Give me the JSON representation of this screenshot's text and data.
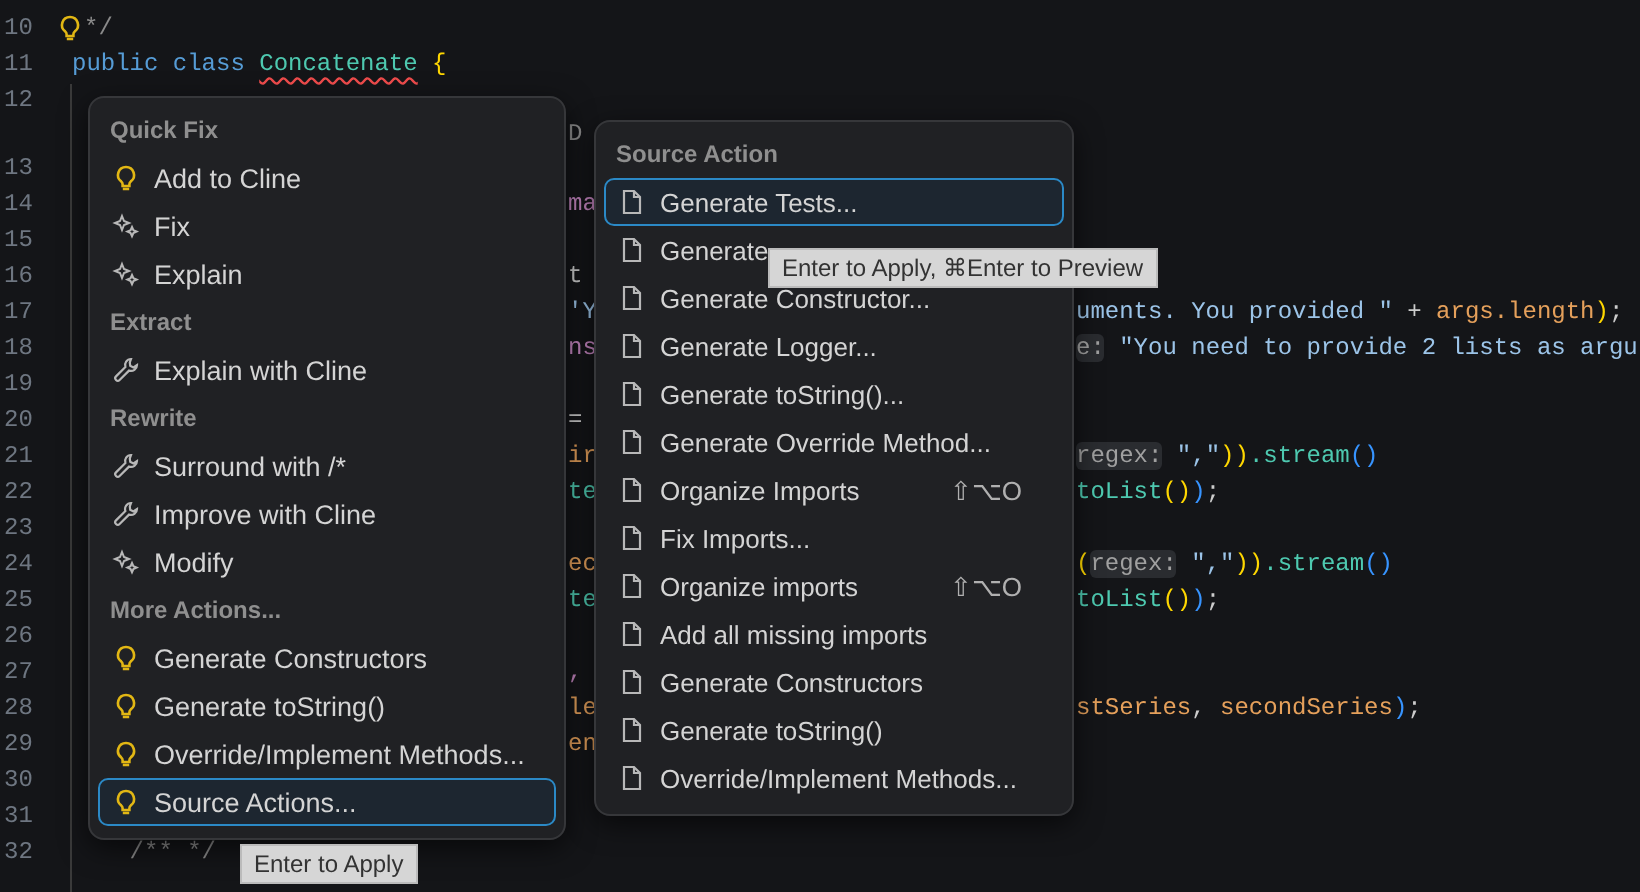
{
  "editor": {
    "lines": [
      {
        "kind": "code",
        "number": "10",
        "lightbulb": true,
        "main": [
          {
            "text": "*/",
            "kind": "comment"
          }
        ]
      },
      {
        "kind": "code",
        "number": "11",
        "main": [
          {
            "text": "public class ",
            "kind": "keyword"
          },
          {
            "text": "Concatenate",
            "kind": "type",
            "error": true
          },
          {
            "text": " {",
            "kind": "paren"
          }
        ]
      },
      {
        "kind": "code",
        "number": "12"
      },
      {
        "kind": "codelens",
        "mid": [
          {
            "text": "D",
            "kind": "lens"
          }
        ]
      },
      {
        "kind": "code",
        "number": "13"
      },
      {
        "kind": "code",
        "number": "14",
        "mid": [
          {
            "text": "ma",
            "kind": "purple"
          }
        ]
      },
      {
        "kind": "code",
        "number": "15"
      },
      {
        "kind": "code",
        "number": "16",
        "mid": [
          {
            "text": "t",
            "kind": "plain"
          }
        ]
      },
      {
        "kind": "code",
        "number": "17",
        "mid": [
          {
            "text": "'Y",
            "kind": "string"
          }
        ],
        "right": [
          {
            "text": "uments. You provided \"",
            "kind": "string"
          },
          {
            "text": " + ",
            "kind": "plain"
          },
          {
            "text": "args.length",
            "kind": "param"
          },
          {
            "text": ")",
            "kind": "paren"
          },
          {
            "text": ";",
            "kind": "plain"
          }
        ]
      },
      {
        "kind": "code",
        "number": "18",
        "mid": [
          {
            "text": "ns",
            "kind": "purple"
          }
        ],
        "right": [
          {
            "text": "e:",
            "kind": "hint"
          },
          {
            "text": " \"You need to provide 2 lists as argu",
            "kind": "string"
          }
        ]
      },
      {
        "kind": "code",
        "number": "19"
      },
      {
        "kind": "code",
        "number": "20",
        "mid": [
          {
            "text": "=",
            "kind": "plain"
          }
        ]
      },
      {
        "kind": "code",
        "number": "21",
        "mid": [
          {
            "text": "ir",
            "kind": "param"
          }
        ],
        "right": [
          {
            "text": "regex:",
            "kind": "hint"
          },
          {
            "text": " \",\"",
            "kind": "string"
          },
          {
            "text": "))",
            "kind": "paren"
          },
          {
            "text": ".stream",
            "kind": "type"
          },
          {
            "text": "()",
            "kind": "paren2"
          }
        ]
      },
      {
        "kind": "code",
        "number": "22",
        "mid": [
          {
            "text": "te",
            "kind": "type"
          }
        ],
        "right": [
          {
            "text": "toList",
            "kind": "type"
          },
          {
            "text": "()",
            "kind": "paren"
          },
          {
            "text": ")",
            "kind": "paren2"
          },
          {
            "text": ";",
            "kind": "plain"
          }
        ]
      },
      {
        "kind": "code",
        "number": "23"
      },
      {
        "kind": "code",
        "number": "24",
        "mid": [
          {
            "text": "ec",
            "kind": "param"
          }
        ],
        "right": [
          {
            "text": "(",
            "kind": "paren"
          },
          {
            "text": "regex:",
            "kind": "hint"
          },
          {
            "text": " \",\"",
            "kind": "string"
          },
          {
            "text": "))",
            "kind": "paren"
          },
          {
            "text": ".stream",
            "kind": "type"
          },
          {
            "text": "()",
            "kind": "paren2"
          }
        ]
      },
      {
        "kind": "code",
        "number": "25",
        "mid": [
          {
            "text": "te",
            "kind": "type"
          }
        ],
        "right": [
          {
            "text": "toList",
            "kind": "type"
          },
          {
            "text": "()",
            "kind": "paren"
          },
          {
            "text": ")",
            "kind": "paren2"
          },
          {
            "text": ";",
            "kind": "plain"
          }
        ]
      },
      {
        "kind": "code",
        "number": "26"
      },
      {
        "kind": "code",
        "number": "27",
        "mid": [
          {
            "text": ",",
            "kind": "purple"
          }
        ]
      },
      {
        "kind": "code",
        "number": "28",
        "mid": [
          {
            "text": "le",
            "kind": "param"
          }
        ],
        "right": [
          {
            "text": "stSeries",
            "kind": "param"
          },
          {
            "text": ", ",
            "kind": "plain"
          },
          {
            "text": "secondSeries",
            "kind": "param"
          },
          {
            "text": ")",
            "kind": "paren2"
          },
          {
            "text": ";",
            "kind": "plain"
          }
        ]
      },
      {
        "kind": "code",
        "number": "29",
        "mid": [
          {
            "text": "en",
            "kind": "param"
          }
        ]
      },
      {
        "kind": "code",
        "number": "30"
      },
      {
        "kind": "code",
        "number": "31"
      },
      {
        "kind": "code",
        "number": "32",
        "main": [
          {
            "text": "    /** */",
            "kind": "comment"
          }
        ]
      }
    ]
  },
  "quick_fix_menu": {
    "sections": [
      {
        "header": "Quick Fix",
        "items": [
          {
            "label": "Add to Cline",
            "kind": "bulb",
            "selected": false
          },
          {
            "label": "Fix",
            "kind": "sparkle",
            "selected": false
          },
          {
            "label": "Explain",
            "kind": "sparkle",
            "selected": false
          }
        ]
      },
      {
        "header": "Extract",
        "items": [
          {
            "label": "Explain with Cline",
            "kind": "wrench",
            "selected": false
          }
        ]
      },
      {
        "header": "Rewrite",
        "items": [
          {
            "label": "Surround with /*",
            "kind": "wrench",
            "selected": false
          },
          {
            "label": "Improve with Cline",
            "kind": "wrench",
            "selected": false
          },
          {
            "label": "Modify",
            "kind": "sparkle",
            "selected": false
          }
        ]
      },
      {
        "header": "More Actions...",
        "items": [
          {
            "label": "Generate Constructors",
            "kind": "bulb",
            "selected": false
          },
          {
            "label": "Generate toString()",
            "kind": "bulb",
            "selected": false
          },
          {
            "label": "Override/Implement Methods...",
            "kind": "bulb",
            "selected": false
          },
          {
            "label": "Source Actions...",
            "kind": "bulb",
            "selected": true
          }
        ]
      }
    ],
    "tooltip": "Enter to Apply"
  },
  "source_action_menu": {
    "header": "Source Action",
    "items": [
      {
        "label": "Generate Tests...",
        "selected": true
      },
      {
        "label": "Generate",
        "selected": false
      },
      {
        "label": "Generate Constructor...",
        "selected": false
      },
      {
        "label": "Generate Logger...",
        "selected": false
      },
      {
        "label": "Generate toString()...",
        "selected": false
      },
      {
        "label": "Generate Override Method...",
        "selected": false
      },
      {
        "label": "Organize Imports",
        "shortcut": "⇧⌥O",
        "selected": false
      },
      {
        "label": "Fix Imports...",
        "selected": false
      },
      {
        "label": "Organize imports",
        "shortcut": "⇧⌥O",
        "selected": false
      },
      {
        "label": "Add all missing imports",
        "selected": false
      },
      {
        "label": "Generate Constructors",
        "selected": false
      },
      {
        "label": "Generate toString()",
        "selected": false
      },
      {
        "label": "Override/Implement Methods...",
        "selected": false
      }
    ],
    "tooltip": "Enter to Apply, ⌘Enter to Preview"
  }
}
